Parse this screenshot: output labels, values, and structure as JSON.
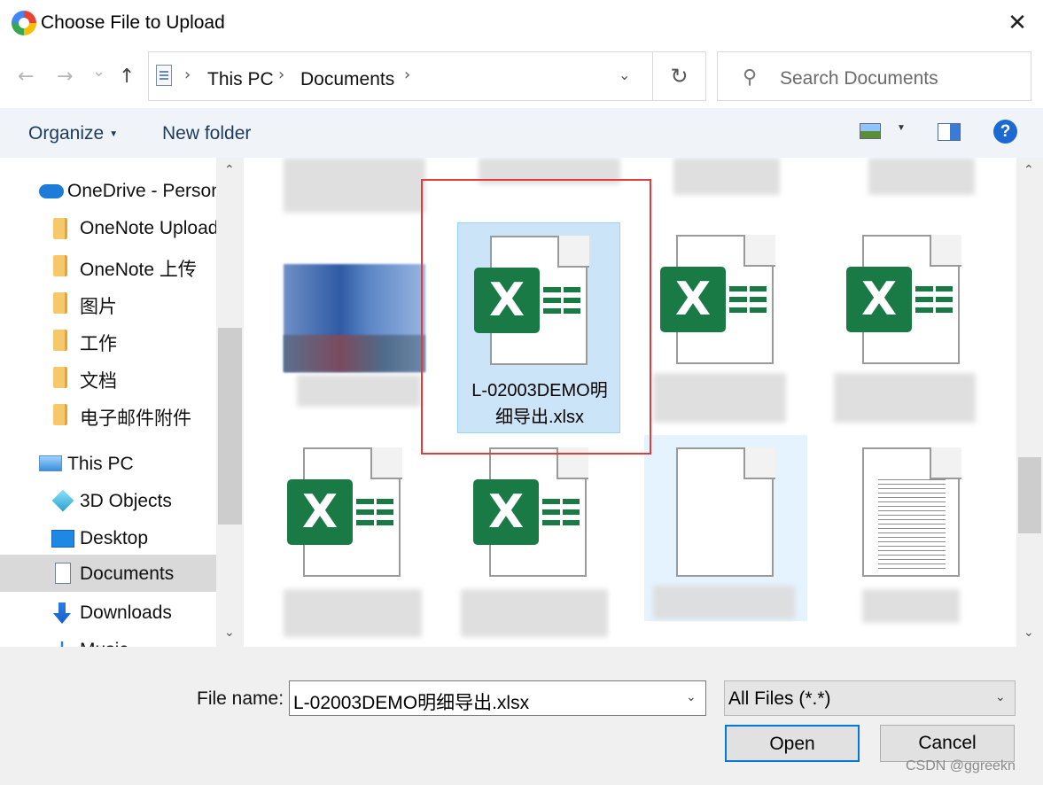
{
  "window": {
    "title": "Choose File to Upload",
    "close_glyph": "✕"
  },
  "nav": {
    "back_glyph": "←",
    "forward_glyph": "→",
    "recent_glyph": "⌄",
    "up_glyph": "↑",
    "breadcrumb": [
      "This PC",
      "Documents"
    ],
    "refresh_glyph": "↻",
    "search_placeholder": "Search Documents"
  },
  "toolbar": {
    "organize_label": "Organize",
    "new_folder_label": "New folder",
    "help_label": "?"
  },
  "sidebar": {
    "items": [
      {
        "label": "OneDrive - Person",
        "icon": "onedrive-icon"
      },
      {
        "label": "OneNote Upload",
        "icon": "folder-icon"
      },
      {
        "label": "OneNote 上传",
        "icon": "folder-icon"
      },
      {
        "label": "图片",
        "icon": "folder-icon"
      },
      {
        "label": "工作",
        "icon": "folder-icon"
      },
      {
        "label": "文档",
        "icon": "folder-icon"
      },
      {
        "label": "电子邮件附件",
        "icon": "folder-icon"
      },
      {
        "label": "This PC",
        "icon": "this-pc-icon"
      },
      {
        "label": "3D Objects",
        "icon": "3d-objects-icon"
      },
      {
        "label": "Desktop",
        "icon": "desktop-icon"
      },
      {
        "label": "Documents",
        "icon": "documents-icon"
      },
      {
        "label": "Downloads",
        "icon": "downloads-icon"
      },
      {
        "label": "Music",
        "icon": "music-icon"
      }
    ],
    "selected": "Documents"
  },
  "files": {
    "selected_name": "L-02003DEMO明细导出.xlsx",
    "selected_name_line1": "L-02003DEMO明",
    "selected_name_line2": "细导出.xlsx",
    "excel_letter": "X"
  },
  "bottom": {
    "file_name_label": "File name:",
    "file_name_value": "L-02003DEMO明细导出.xlsx",
    "filter_value": "All Files (*.*)",
    "open_label": "Open",
    "cancel_label": "Cancel",
    "watermark": "CSDN @ggreekn"
  }
}
